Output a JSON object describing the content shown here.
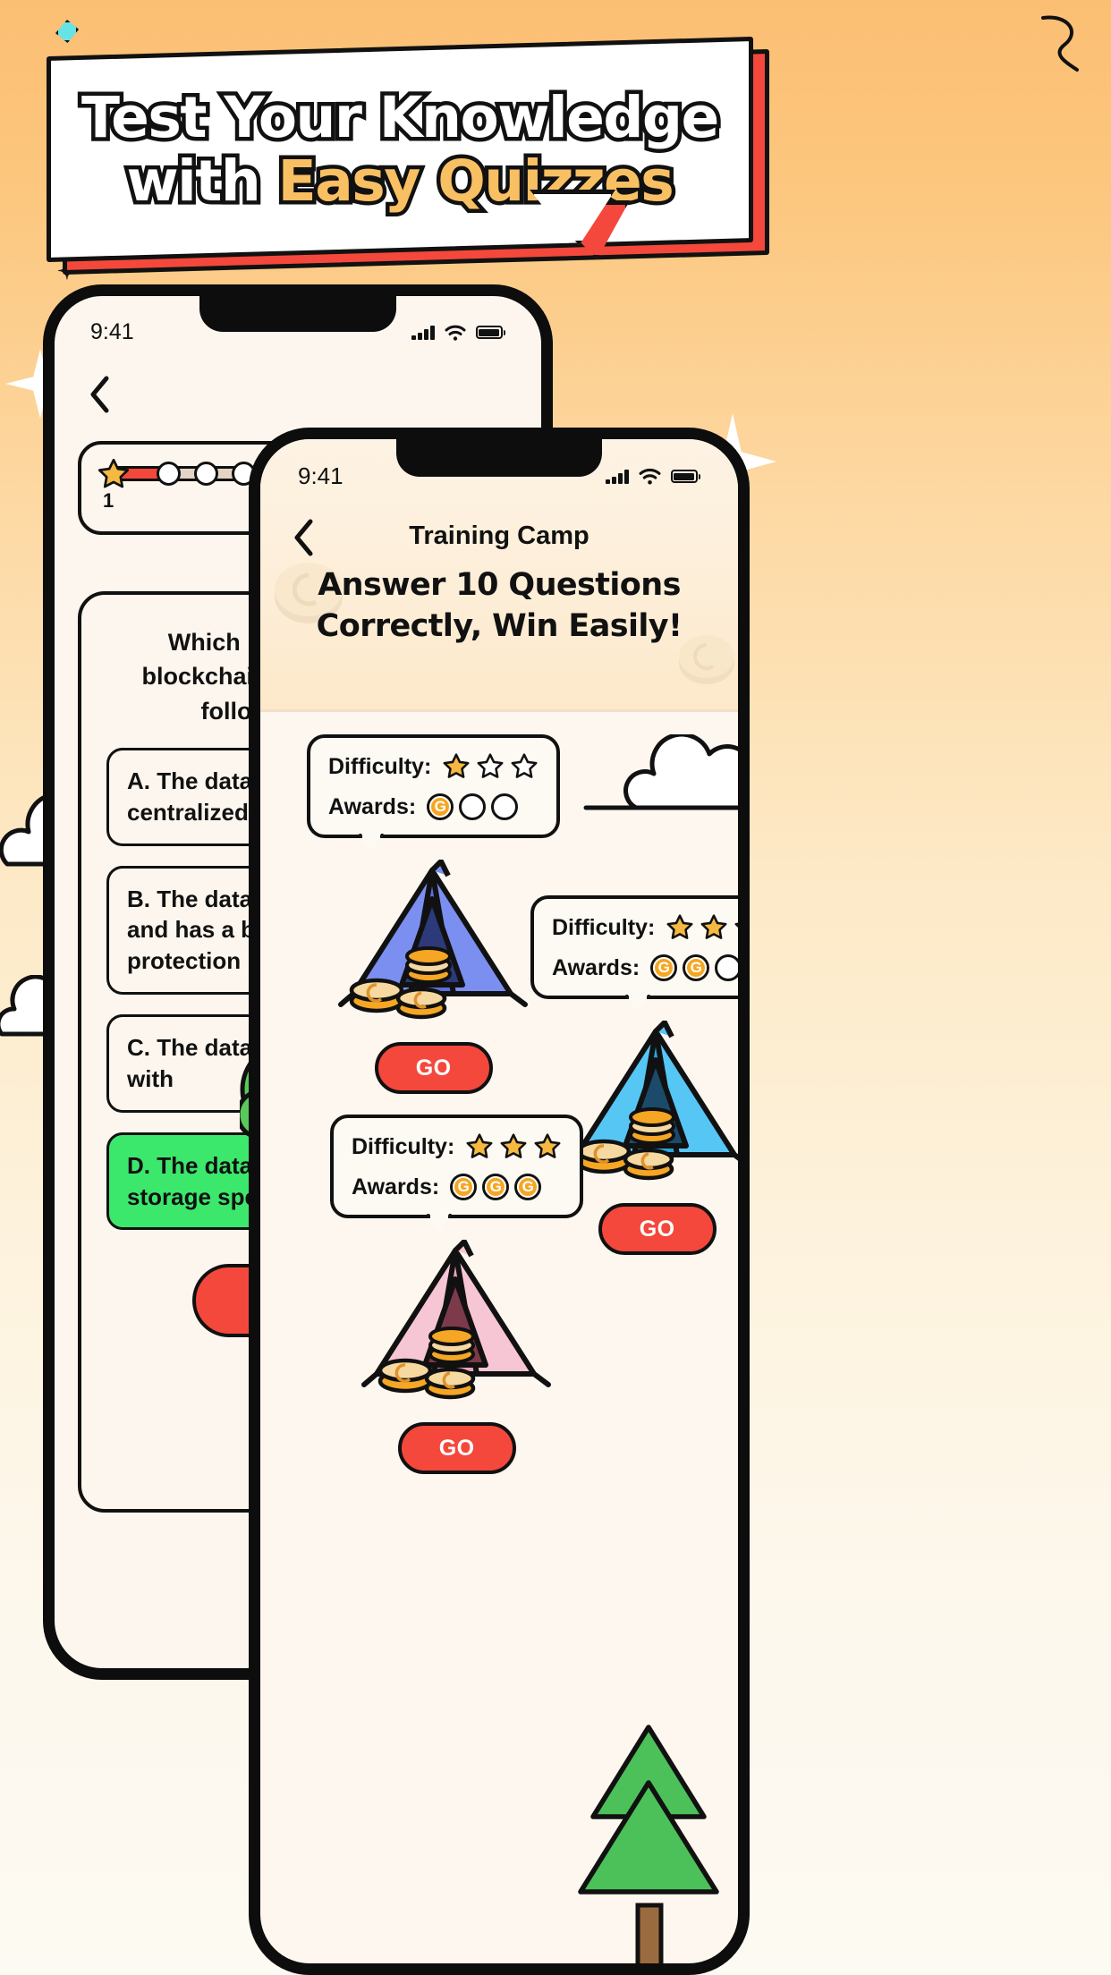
{
  "promo": {
    "headline_line1": "Test Your Knowledge",
    "headline_line2_plain": "with ",
    "headline_line2_accent": "Easy Quizzes",
    "accent_color": "#f9bf63",
    "banner_shadow_color": "#f4483c"
  },
  "back_phone": {
    "status": {
      "time": "9:41",
      "signal": "signal-bars-icon",
      "wifi": "wifi-icon",
      "battery": "battery-icon"
    },
    "back_button": "chevron-left-icon",
    "progress": {
      "current": "1",
      "target": "4",
      "fill_color": "#f4483c",
      "track_color": "#e3d4c3"
    },
    "question": "Which is not a feature of blockchain technology in the following options?",
    "options": [
      {
        "key": "A",
        "text": "A. The data owner can be a centralized organization"
      },
      {
        "key": "B",
        "text": "B. The data is not modifiable and has a better privacy protection"
      },
      {
        "key": "C",
        "text": "C. The data cannot be tampered with"
      },
      {
        "key": "D",
        "text": "D. The data processing and storage speed is fast",
        "state": "correct"
      }
    ],
    "submit_label": ""
  },
  "front_phone": {
    "status": {
      "time": "9:41",
      "signal": "signal-bars-icon",
      "wifi": "wifi-icon",
      "battery": "battery-icon"
    },
    "back_button": "chevron-left-icon",
    "title": "Training Camp",
    "headline_line1": "Answer 10 Questions",
    "headline_line2": "Correctly, Win Easily!",
    "labels": {
      "difficulty": "Difficulty:",
      "awards": "Awards:"
    },
    "coin_letter": "G",
    "camps": [
      {
        "id": "camp-easy",
        "difficulty_filled": 1,
        "difficulty_total": 3,
        "awards_filled": 1,
        "awards_total": 3,
        "tent_color": "#7b8ff0",
        "tent_dark": "#5c6fd8",
        "go_label": "GO"
      },
      {
        "id": "camp-medium",
        "difficulty_filled": 2,
        "difficulty_total": 3,
        "awards_filled": 2,
        "awards_total": 3,
        "tent_color": "#56c6f5",
        "tent_dark": "#2ba6da",
        "go_label": "GO"
      },
      {
        "id": "camp-hard",
        "difficulty_filled": 3,
        "difficulty_total": 3,
        "awards_filled": 3,
        "awards_total": 3,
        "tent_color": "#f7c6d4",
        "tent_dark": "#e9a4b8",
        "go_label": "GO"
      }
    ]
  },
  "colors": {
    "background_top": "#fbbf73",
    "background_bottom": "#fdfaf3",
    "star_fill": "#f5b942",
    "coin_fill": "#f5a623",
    "accent_red": "#f4483c",
    "correct_green": "#3ce86b",
    "ink": "#111111"
  }
}
